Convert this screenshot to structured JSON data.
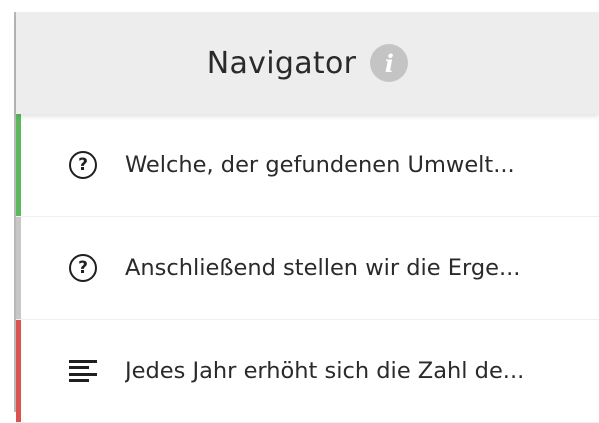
{
  "navigator": {
    "title": "Navigator",
    "info_glyph": "i",
    "items": [
      {
        "icon": "question-circle-icon",
        "label": "Welche, der gefundenen Umwelt...",
        "status_color": "#5cb85c"
      },
      {
        "icon": "question-circle-icon",
        "label": "Anschließend stellen wir die Erge...",
        "status_color": "#c7c7c7"
      },
      {
        "icon": "text-lines-icon",
        "label": "Jedes Jahr erhöht sich die Zahl de...",
        "status_color": "#d9534f"
      }
    ]
  }
}
